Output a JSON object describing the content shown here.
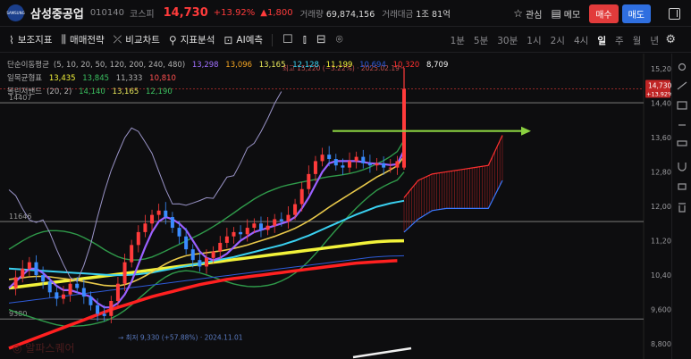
{
  "header": {
    "logo_text": "SAMSUNG",
    "stock_name": "삼성중공업",
    "stock_code": "010140",
    "market": "코스피",
    "price": "14,730",
    "change_pct": "+13.92%",
    "change_amount": "▲1,800",
    "volume_label": "거래량",
    "volume_value": "69,874,156",
    "amount_label": "거래대금",
    "amount_value": "1조 81억",
    "watch_label": "관심",
    "memo_label": "메모",
    "buy_label": "매수",
    "sell_label": "매도"
  },
  "toolbar": {
    "items": [
      {
        "icon": "indicator-icon",
        "label": "보조지표"
      },
      {
        "icon": "strategy-icon",
        "label": "매매전략"
      },
      {
        "icon": "compare-icon",
        "label": "비교차트"
      },
      {
        "icon": "analysis-icon",
        "label": "지표분석"
      },
      {
        "icon": "ai-icon",
        "label": "AI예측"
      }
    ],
    "periods": [
      "1분",
      "5분",
      "30분",
      "1시",
      "2시",
      "4시",
      "일",
      "주",
      "월",
      "년"
    ],
    "active_period": "일"
  },
  "legends": {
    "ma": {
      "label": "단순이동평균",
      "params": "(5, 10, 20, 50, 120, 200, 240, 480)",
      "values": [
        {
          "v": "13,298",
          "c": "#a070ff"
        },
        {
          "v": "13,096",
          "c": "#f5a623"
        },
        {
          "v": "13,165",
          "c": "#e8e85a"
        },
        {
          "v": "12,128",
          "c": "#3ad0f0"
        },
        {
          "v": "11,199",
          "c": "#f2f23a"
        },
        {
          "v": "10,694",
          "c": "#2e5bd8"
        },
        {
          "v": "10,320",
          "c": "#ff3030"
        },
        {
          "v": "8,709",
          "c": "#f2f2f2"
        }
      ]
    },
    "ichimoku": {
      "label": "일목균형표",
      "values": [
        {
          "v": "13,435",
          "c": "#f2f23a"
        },
        {
          "v": "13,845",
          "c": "#3ac060"
        },
        {
          "v": "11,333",
          "c": "#b0b0b0"
        },
        {
          "v": "10,810",
          "c": "#ff5050"
        }
      ]
    },
    "bollinger": {
      "label": "볼린저밴드",
      "params": "(20, 2)",
      "values": [
        {
          "v": "14,140",
          "c": "#3ac060"
        },
        {
          "v": "13,165",
          "c": "#e8e85a"
        },
        {
          "v": "12,190",
          "c": "#3ac060"
        }
      ]
    }
  },
  "chart_data": {
    "type": "line",
    "title": "",
    "price_axis": {
      "ticks": [
        15200,
        14400,
        13600,
        12800,
        12000,
        11200,
        10400,
        9600,
        8800
      ],
      "tick_labels": [
        "15,200",
        "14,400",
        "13,600",
        "12,800",
        "12,000",
        "11,200",
        "10,400",
        "9,600",
        "8,800"
      ],
      "range": [
        8450,
        15550
      ]
    },
    "current_price": {
      "value": 14730,
      "label": "14,730",
      "change": "+13.92%"
    },
    "levels": [
      {
        "value": 14407,
        "label": "14407"
      },
      {
        "value": 11646,
        "label": "11646"
      },
      {
        "value": 9380,
        "label": "9380"
      }
    ],
    "high_annotation": "최고 15,220 (−3.22%) · 2025.02.19",
    "low_annotation": "최저 9,330 (+57.88%) · 2024.11.01",
    "watermark": "알파스퀘어",
    "series_samples": {
      "close": [
        10100,
        10350,
        10550,
        10700,
        10400,
        10250,
        10000,
        9850,
        9950,
        10200,
        10100,
        9900,
        9700,
        9500,
        9450,
        9800,
        10200,
        10700,
        11100,
        11400,
        11600,
        11800,
        11900,
        11750,
        11500,
        11300,
        11000,
        10750,
        10600,
        10800,
        10950,
        11150,
        11300,
        11400,
        11350,
        11500,
        11600,
        11450,
        11550,
        11700,
        11650,
        11800,
        12050,
        12400,
        12750,
        13050,
        13200,
        13100,
        12950,
        12900,
        13050,
        13150,
        13000,
        12950,
        13000,
        12900,
        12900,
        13050,
        14730
      ],
      "ma5": [
        10100,
        10250,
        10400,
        10550,
        10550,
        10450,
        10300,
        10150,
        10050,
        10050,
        10000,
        9950,
        9900,
        9750,
        9650,
        9650,
        9750,
        9950,
        10250,
        10650,
        11050,
        11400,
        11650,
        11750,
        11700,
        11600,
        11450,
        11200,
        10950,
        10800,
        10750,
        10800,
        10900,
        11050,
        11200,
        11300,
        11400,
        11450,
        11500,
        11550,
        11600,
        11650,
        11750,
        11950,
        12200,
        12500,
        12800,
        13000,
        13050,
        13050,
        13050,
        13050,
        13030,
        13000,
        12990,
        12980,
        12960,
        12980,
        13298
      ],
      "ma20": [
        10300,
        10320,
        10340,
        10360,
        10370,
        10370,
        10360,
        10340,
        10320,
        10300,
        10280,
        10250,
        10220,
        10190,
        10160,
        10150,
        10150,
        10180,
        10230,
        10300,
        10380,
        10470,
        10570,
        10660,
        10740,
        10800,
        10850,
        10880,
        10900,
        10920,
        10940,
        10960,
        10990,
        11020,
        11060,
        11100,
        11150,
        11200,
        11250,
        11300,
        11360,
        11420,
        11490,
        11570,
        11660,
        11760,
        11870,
        11980,
        12080,
        12180,
        12280,
        12380,
        12480,
        12580,
        12680,
        12760,
        12850,
        12940,
        13165
      ],
      "ma50": [
        10550,
        10540,
        10530,
        10520,
        10510,
        10500,
        10490,
        10480,
        10470,
        10460,
        10450,
        10440,
        10430,
        10420,
        10410,
        10400,
        10400,
        10400,
        10410,
        10420,
        10440,
        10460,
        10490,
        10520,
        10550,
        10580,
        10610,
        10640,
        10670,
        10700,
        10730,
        10760,
        10790,
        10820,
        10860,
        10900,
        10940,
        10980,
        11020,
        11060,
        11100,
        11150,
        11200,
        11260,
        11320,
        11390,
        11460,
        11530,
        11600,
        11670,
        11740,
        11810,
        11870,
        11930,
        11990,
        12030,
        12070,
        12100,
        12128
      ],
      "ma120": [
        10100,
        10120,
        10140,
        10160,
        10180,
        10200,
        10220,
        10240,
        10260,
        10280,
        10300,
        10320,
        10340,
        10360,
        10380,
        10400,
        10420,
        10440,
        10460,
        10480,
        10500,
        10520,
        10540,
        10560,
        10580,
        10600,
        10620,
        10640,
        10660,
        10680,
        10700,
        10720,
        10740,
        10760,
        10780,
        10800,
        10820,
        10840,
        10860,
        10880,
        10900,
        10920,
        10940,
        10960,
        10980,
        11000,
        11020,
        11040,
        11060,
        11080,
        11100,
        11120,
        11140,
        11160,
        11175,
        11185,
        11192,
        11196,
        11199
      ],
      "ma240": [
        8700,
        8760,
        8820,
        8880,
        8940,
        9000,
        9060,
        9120,
        9180,
        9240,
        9300,
        9360,
        9420,
        9480,
        9540,
        9600,
        9650,
        9700,
        9750,
        9800,
        9850,
        9900,
        9940,
        9980,
        10020,
        10060,
        10100,
        10140,
        10180,
        10210,
        10240,
        10270,
        10300,
        10320,
        10340,
        10360,
        10380,
        10400,
        10420,
        10440,
        10460,
        10480,
        10500,
        10520,
        10540,
        10560,
        10580,
        10600,
        10620,
        10640,
        10660,
        10680,
        10690,
        10700,
        10710,
        10720,
        10730,
        10735,
        10320
      ]
    }
  },
  "right_strip": {
    "icons": [
      "crosshair-icon",
      "trend-line-icon",
      "fib-icon",
      "text-tool-icon",
      "ruler-icon",
      "magnet-icon",
      "lock-icon",
      "trash-icon"
    ]
  }
}
